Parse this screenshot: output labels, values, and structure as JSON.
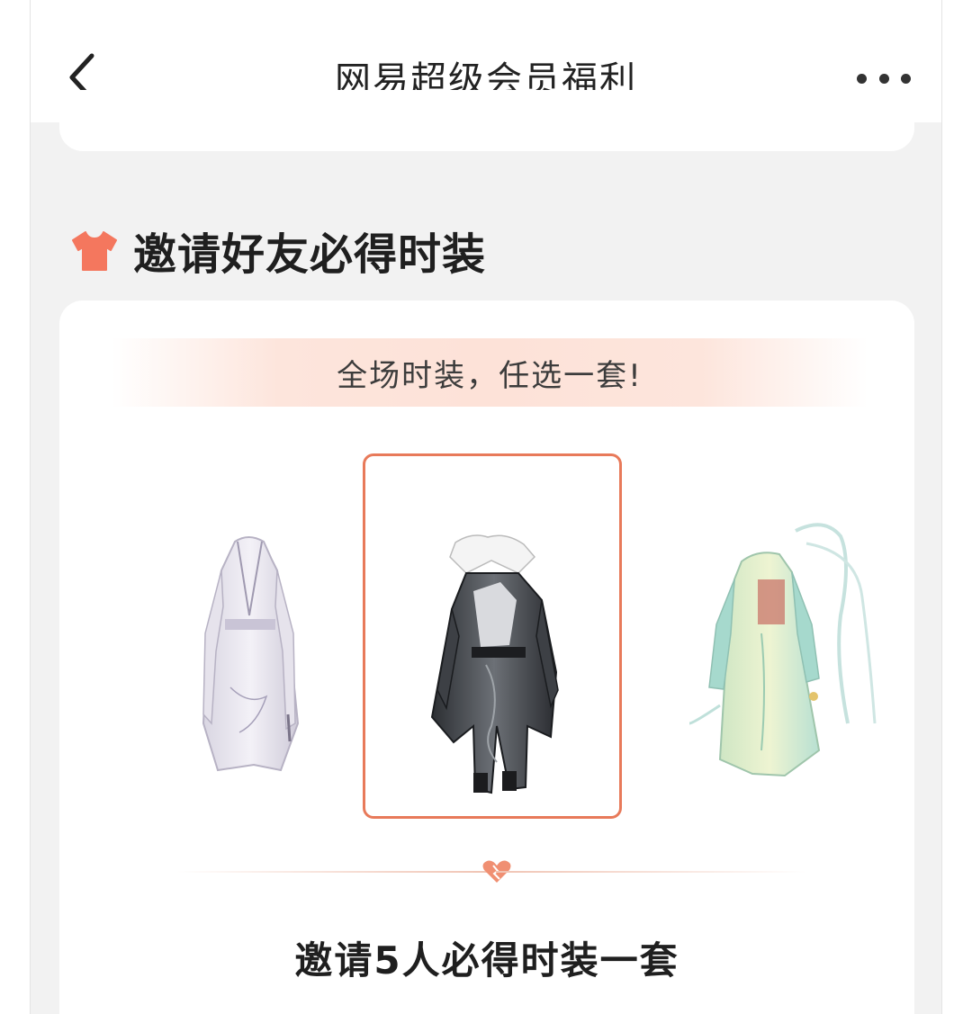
{
  "header": {
    "title": "网易超级会员福利"
  },
  "section": {
    "title": "邀请好友必得时装",
    "icon": "shirt-icon"
  },
  "card": {
    "banner_text": "全场时装，任选一套!",
    "outfits": [
      {
        "name": "white-robe-outfit",
        "selected": false
      },
      {
        "name": "black-robe-outfit",
        "selected": true
      },
      {
        "name": "green-dress-outfit",
        "selected": false
      }
    ],
    "invite_text": "邀请5人必得时装一套"
  },
  "colors": {
    "accent": "#e87a5a",
    "background": "#f2f2f2"
  }
}
